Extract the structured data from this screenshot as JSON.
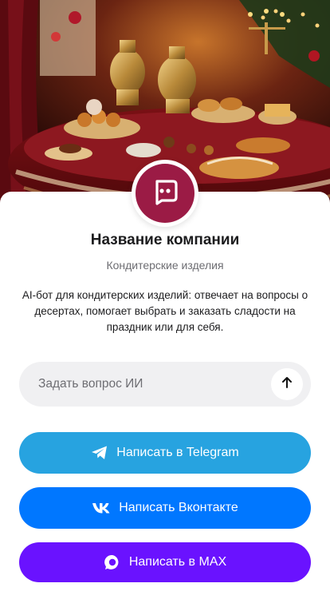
{
  "company": {
    "name": "Название компании",
    "category": "Кондитерские изделия",
    "description": "AI-бот для кондитерских изделий: отвечает на вопросы о десертах, помогает выбрать и заказать сладости на праздник или для себя.",
    "avatar_icon": "chat-bot-icon"
  },
  "ask": {
    "placeholder": "Задать вопрос ИИ",
    "send_icon": "arrow-up-icon"
  },
  "buttons": {
    "telegram": {
      "label": "Написать в Telegram",
      "icon": "telegram-icon"
    },
    "vk": {
      "label": "Написать Вконтакте",
      "icon": "vk-icon"
    },
    "max": {
      "label": "Написать в MAX",
      "icon": "max-icon"
    }
  },
  "colors": {
    "avatar_bg": "#9b1b45",
    "telegram": "#27a3e0",
    "vk": "#0077ff",
    "max": "#6a12ff",
    "ask_bg": "#f0f0f2"
  }
}
